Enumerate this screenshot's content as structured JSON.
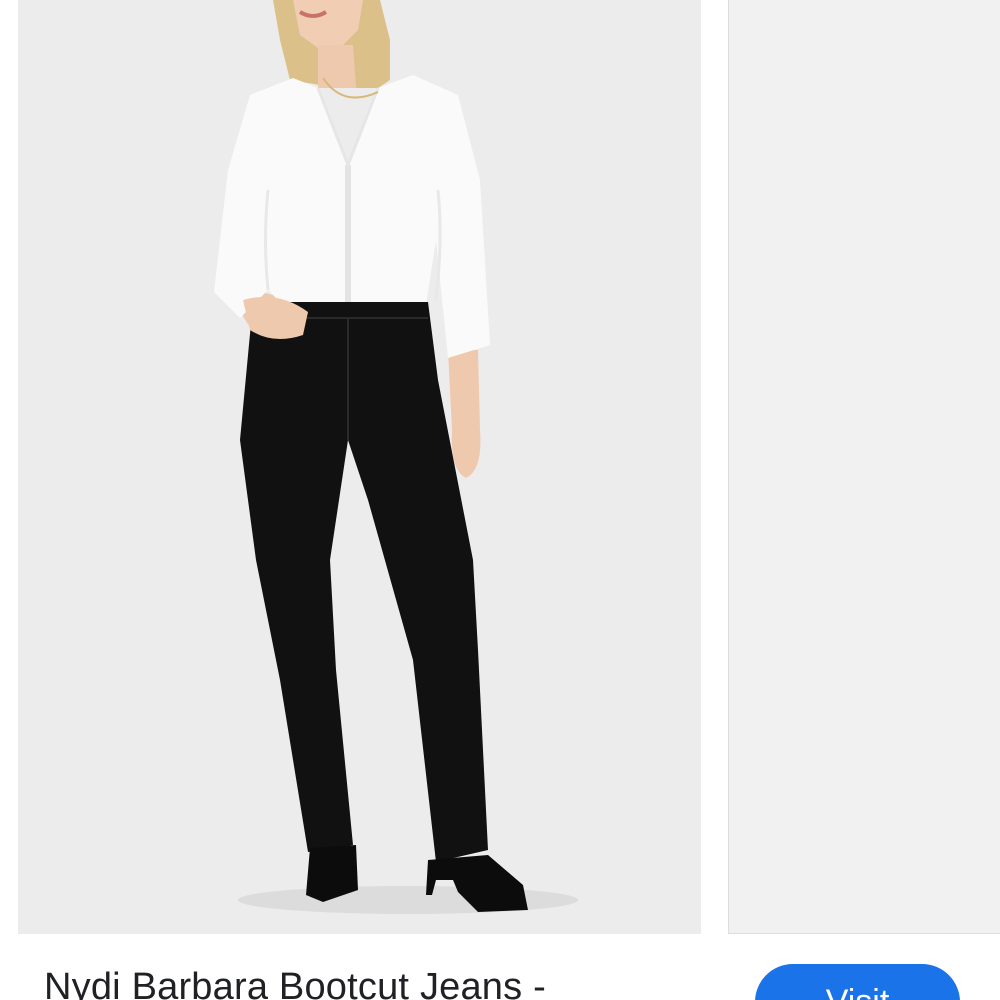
{
  "product": {
    "title": "Nydi Barbara Bootcut Jeans -",
    "image_alt": "Model wearing white blouse and black bootcut jeans with black ankle boots"
  },
  "actions": {
    "visit_label": "Visit"
  },
  "colors": {
    "image_background": "#ececec",
    "accent": "#1a73e8",
    "title_text": "#202124"
  }
}
